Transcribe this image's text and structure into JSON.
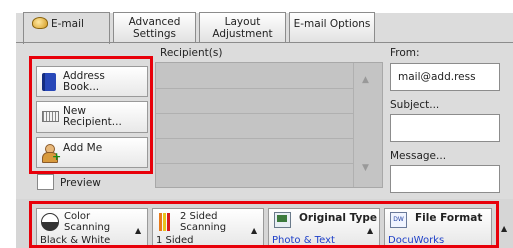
{
  "tabs": [
    {
      "label": "E-mail",
      "active": true,
      "icon": "email-envelope-icon"
    },
    {
      "label_line1": "Advanced",
      "label_line2": "Settings"
    },
    {
      "label_line1": "Layout",
      "label_line2": "Adjustment"
    },
    {
      "label": "E-mail Options"
    }
  ],
  "left_buttons": {
    "address_book": {
      "line1": "Address",
      "line2": "Book...",
      "icon": "address-book-icon"
    },
    "new_recipient": {
      "line1": "New",
      "line2": "Recipient...",
      "icon": "keyboard-icon"
    },
    "add_me": {
      "label": "Add Me",
      "icon": "person-add-icon"
    }
  },
  "preview": {
    "label": "Preview",
    "checked": false
  },
  "recipients": {
    "header": "Recipient(s)",
    "rows": 5
  },
  "fields": {
    "from_label": "From:",
    "from_value": "mail@add.ress",
    "subject_label": "Subject...",
    "subject_value": "",
    "message_label": "Message...",
    "message_value": ""
  },
  "bottom_buttons": {
    "color": {
      "line1": "Color",
      "line2": "Scanning",
      "value": "Black & White",
      "icon": "color-mode-icon"
    },
    "sided": {
      "line1": "2 Sided",
      "line2": "Scanning",
      "value": "1 Sided",
      "icon": "duplex-icon"
    },
    "type": {
      "label": "Original Type",
      "value": "Photo & Text",
      "icon": "original-type-icon"
    },
    "format": {
      "label": "File Format",
      "value": "DocuWorks",
      "icon": "file-format-icon",
      "icon_text": "DW"
    }
  },
  "colors": {
    "highlight": "#e8000a",
    "value_blue": "#1e40c8"
  }
}
